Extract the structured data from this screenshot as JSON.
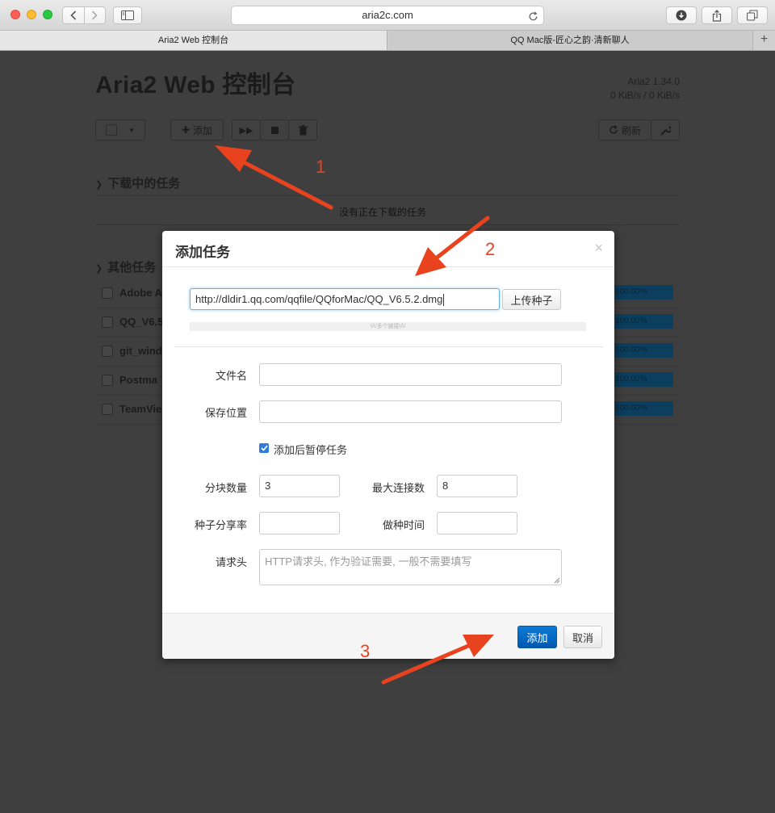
{
  "browser": {
    "url": "aria2c.com",
    "tabs": [
      {
        "label": "Aria2 Web 控制台",
        "active": true
      },
      {
        "label": "QQ Mac版-匠心之韵·清新聊人",
        "active": false
      }
    ],
    "new_tab": "+"
  },
  "page": {
    "title": "Aria2 Web 控制台",
    "version": "Aria2 1.34.0",
    "speed": "0 KiB/s / 0 KiB/s",
    "toolbar": {
      "add_label": "添加",
      "refresh_label": "刷新"
    },
    "downloading": {
      "heading": "下载中的任务",
      "empty": "没有正在下载的任务"
    },
    "others": {
      "heading": "其他任务",
      "items": [
        {
          "name": "Adobe A",
          "progress": "100.00%"
        },
        {
          "name": "QQ_V6.5",
          "progress": "100.00%"
        },
        {
          "name": "git_wind",
          "progress": "100.00%"
        },
        {
          "name": "Postma",
          "progress": "100.00%"
        },
        {
          "name": "TeamVie",
          "progress": "100.00%"
        }
      ]
    }
  },
  "modal": {
    "title": "添加任务",
    "close": "×",
    "url_value": "http://dldir1.qq.com/qqfile/QQforMac/QQ_V6.5.2.dmg",
    "upload_label": "上传种子",
    "multi_hint": "\\/\\/多个链接\\/\\/",
    "filename_label": "文件名",
    "filename_value": "",
    "save_label": "保存位置",
    "save_value": "",
    "pause_label": "添加后暂停任务",
    "pause_checked": true,
    "split_label": "分块数量",
    "split_value": "3",
    "max_conn_label": "最大连接数",
    "max_conn_value": "8",
    "seed_ratio_label": "种子分享率",
    "seed_ratio_value": "",
    "seed_time_label": "做种时间",
    "seed_time_value": "",
    "header_label": "请求头",
    "header_placeholder": "HTTP请求头, 作为验证需要, 一般不需要填写",
    "add_button": "添加",
    "cancel_button": "取消"
  },
  "annotations": {
    "step1": "1",
    "step2": "2",
    "step3": "3",
    "color": "#e8421f"
  }
}
